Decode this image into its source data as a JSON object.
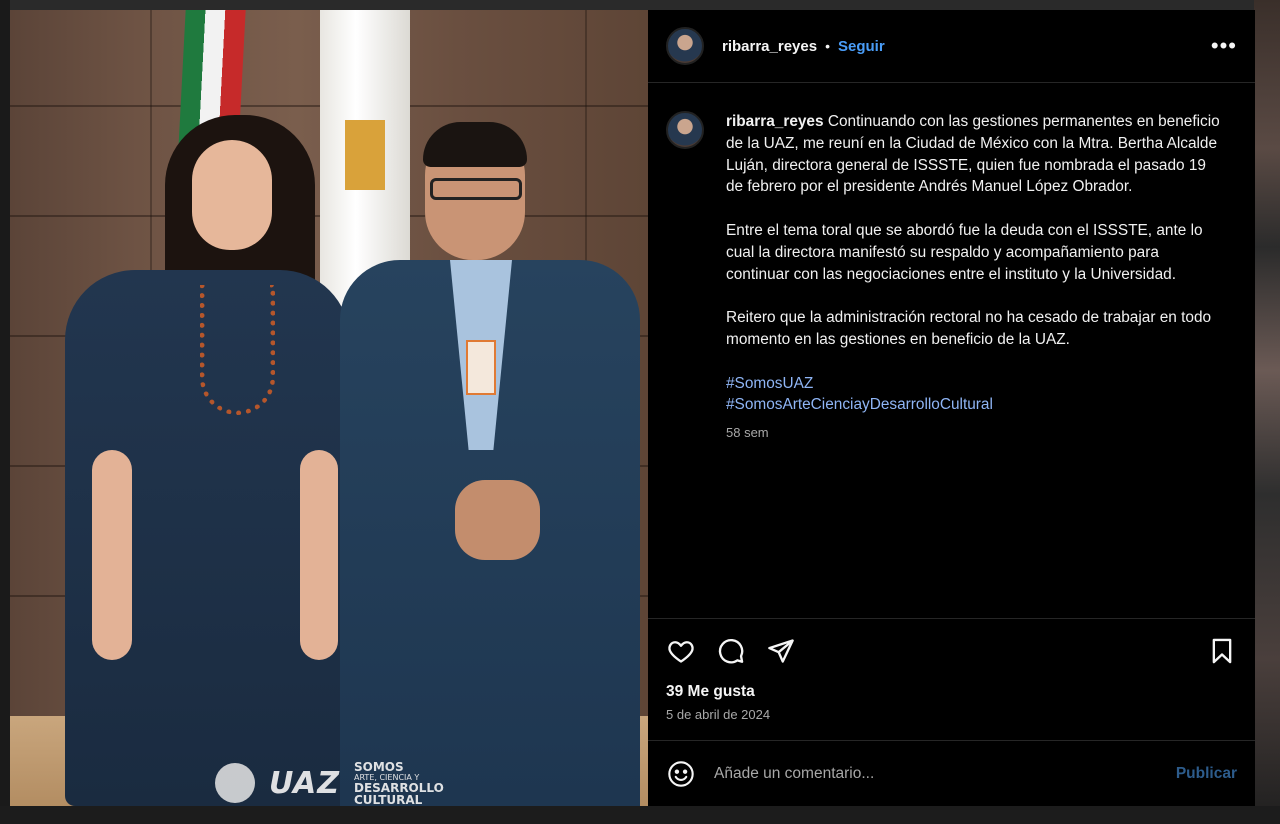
{
  "post": {
    "username": "ribarra_reyes",
    "separator": "•",
    "follow_label": "Seguir",
    "more_label": "•••",
    "caption": {
      "username": "ribarra_reyes",
      "paragraph1": "Continuando con las gestiones permanentes en beneficio de la UAZ, me reuní en la Ciudad de México con la Mtra. Bertha Alcalde Luján, directora general de ISSSTE, quien fue nombrada el pasado 19 de febrero por el presidente Andrés Manuel López Obrador.",
      "paragraph2": "Entre el tema toral que se abordó fue la deuda con el ISSSTE, ante lo cual la directora manifestó su respaldo y acompañamiento para continuar con las negociaciones entre el instituto y la Universidad.",
      "paragraph3": "Reitero que la administración rectoral no ha cesado de trabajar en todo momento en las gestiones en beneficio de la UAZ.",
      "hashtags": [
        "#SomosUAZ",
        "#SomosArteCienciayDesarrolloCultural"
      ],
      "age": "58 sem"
    },
    "likes": "39 Me gusta",
    "date": "5 de abril de 2024",
    "comment_placeholder": "Añade un comentario...",
    "publish_label": "Publicar",
    "photo_logos": {
      "uaz": "UAZ",
      "somos": "SOMOS",
      "somos_line2": "ARTE, CIENCIA Y",
      "somos_line3": "DESARROLLO",
      "somos_line4": "CULTURAL"
    },
    "icons": [
      "heart-icon",
      "comment-icon",
      "share-icon",
      "bookmark-icon",
      "emoji-icon",
      "more-icon"
    ],
    "colors": {
      "follow": "#4a9df8",
      "hashtag": "#8fb5f5",
      "publish": "#2d5c8c",
      "background": "#000000"
    }
  }
}
